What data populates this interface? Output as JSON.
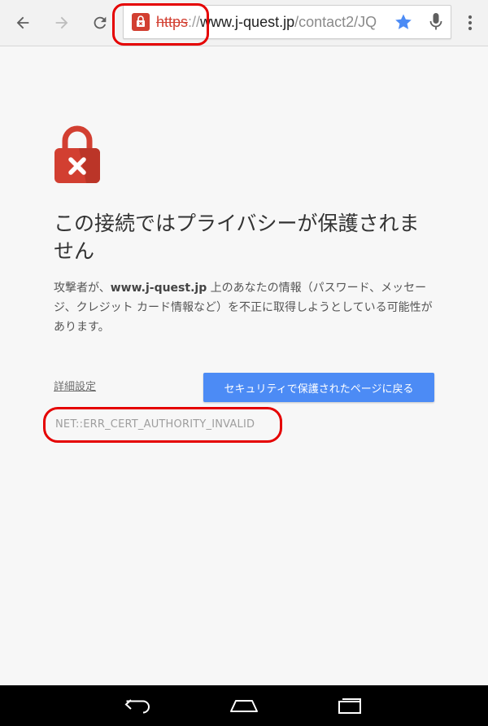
{
  "toolbar": {
    "url": {
      "scheme": "https",
      "separator": "://",
      "host": "www.j-quest.jp",
      "path": "/contact2/JQ"
    },
    "icons": {
      "back": "back-arrow-icon",
      "forward": "forward-arrow-icon",
      "reload": "reload-icon",
      "security": "broken-lock-icon",
      "bookmark": "star-icon",
      "voice": "microphone-icon",
      "menu": "overflow-menu-icon"
    }
  },
  "interstitial": {
    "icon": "red-lock-x-icon",
    "heading": "この接続ではプライバシーが保護されません",
    "body_prefix": "攻撃者が、",
    "body_host": "www.j-quest.jp",
    "body_suffix": " 上のあなたの情報（パスワード、メッセージ、クレジット カード情報など）を不正に取得しようとしている可能性があります。",
    "details_label": "詳細設定",
    "back_button_label": "セキュリティで保護されたページに戻る",
    "error_code": "NET::ERR_CERT_AUTHORITY_INVALID"
  },
  "navbar": {
    "icons": [
      "nav-back-icon",
      "nav-home-icon",
      "nav-recents-icon"
    ]
  },
  "colors": {
    "accent_blue": "#4c8bf5",
    "error_red": "#d23f31",
    "annotation_red": "#e50000"
  }
}
